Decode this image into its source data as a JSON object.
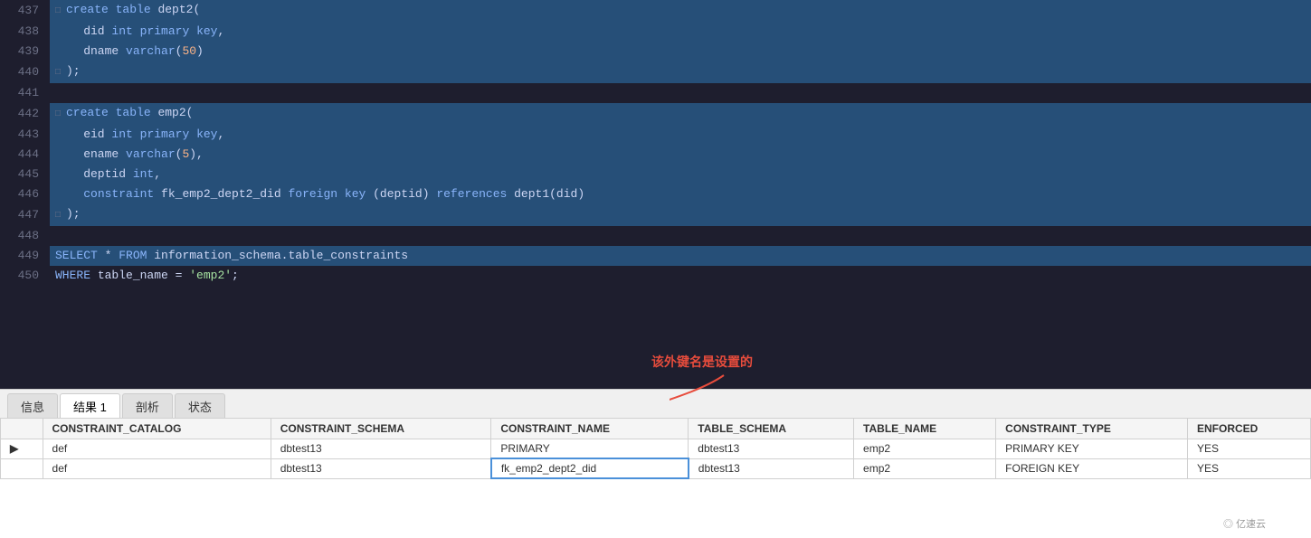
{
  "editor": {
    "lines": [
      {
        "num": "437",
        "selected": true,
        "content": [
          {
            "t": "□ ",
            "cls": "collapse-icon"
          },
          {
            "t": "create",
            "cls": "kw"
          },
          {
            "t": " ",
            "cls": "plain"
          },
          {
            "t": "table",
            "cls": "kw"
          },
          {
            "t": " dept2(",
            "cls": "plain"
          }
        ]
      },
      {
        "num": "438",
        "selected": true,
        "content": [
          {
            "t": "    did ",
            "cls": "plain"
          },
          {
            "t": "int",
            "cls": "kw"
          },
          {
            "t": " ",
            "cls": "plain"
          },
          {
            "t": "primary",
            "cls": "kw"
          },
          {
            "t": " ",
            "cls": "plain"
          },
          {
            "t": "key",
            "cls": "kw"
          },
          {
            "t": ",",
            "cls": "plain"
          }
        ]
      },
      {
        "num": "439",
        "selected": true,
        "content": [
          {
            "t": "    dname ",
            "cls": "plain"
          },
          {
            "t": "varchar",
            "cls": "kw"
          },
          {
            "t": "(",
            "cls": "plain"
          },
          {
            "t": "50",
            "cls": "num"
          },
          {
            "t": ")",
            "cls": "plain"
          }
        ]
      },
      {
        "num": "440",
        "selected": true,
        "content": [
          {
            "t": "□ ",
            "cls": "collapse-icon"
          },
          {
            "t": ");",
            "cls": "plain"
          }
        ]
      },
      {
        "num": "441",
        "selected": false,
        "content": []
      },
      {
        "num": "442",
        "selected": true,
        "content": [
          {
            "t": "□ ",
            "cls": "collapse-icon"
          },
          {
            "t": "create",
            "cls": "kw"
          },
          {
            "t": " ",
            "cls": "plain"
          },
          {
            "t": "table",
            "cls": "kw"
          },
          {
            "t": " emp2(",
            "cls": "plain"
          }
        ]
      },
      {
        "num": "443",
        "selected": true,
        "content": [
          {
            "t": "    eid ",
            "cls": "plain"
          },
          {
            "t": "int",
            "cls": "kw"
          },
          {
            "t": " ",
            "cls": "plain"
          },
          {
            "t": "primary",
            "cls": "kw"
          },
          {
            "t": " ",
            "cls": "plain"
          },
          {
            "t": "key",
            "cls": "kw"
          },
          {
            "t": ",",
            "cls": "plain"
          }
        ]
      },
      {
        "num": "444",
        "selected": true,
        "content": [
          {
            "t": "    ename ",
            "cls": "plain"
          },
          {
            "t": "varchar",
            "cls": "kw"
          },
          {
            "t": "(",
            "cls": "plain"
          },
          {
            "t": "5",
            "cls": "num"
          },
          {
            "t": "),",
            "cls": "plain"
          }
        ]
      },
      {
        "num": "445",
        "selected": true,
        "content": [
          {
            "t": "    deptid ",
            "cls": "plain"
          },
          {
            "t": "int",
            "cls": "kw"
          },
          {
            "t": ",",
            "cls": "plain"
          }
        ]
      },
      {
        "num": "446",
        "selected": true,
        "content": [
          {
            "t": "    ",
            "cls": "plain"
          },
          {
            "t": "constraint",
            "cls": "kw"
          },
          {
            "t": " fk_emp2_dept2_did ",
            "cls": "plain"
          },
          {
            "t": "foreign",
            "cls": "kw"
          },
          {
            "t": " ",
            "cls": "plain"
          },
          {
            "t": "key",
            "cls": "kw"
          },
          {
            "t": " (deptid) ",
            "cls": "plain"
          },
          {
            "t": "references",
            "cls": "kw"
          },
          {
            "t": " dept1(did)",
            "cls": "plain"
          }
        ]
      },
      {
        "num": "447",
        "selected": true,
        "content": [
          {
            "t": "□ ",
            "cls": "collapse-icon"
          },
          {
            "t": ");",
            "cls": "plain"
          }
        ]
      },
      {
        "num": "448",
        "selected": false,
        "content": []
      },
      {
        "num": "449",
        "selected": true,
        "content": [
          {
            "t": "SELECT",
            "cls": "kw"
          },
          {
            "t": " * ",
            "cls": "plain"
          },
          {
            "t": "FROM",
            "cls": "kw"
          },
          {
            "t": " information_schema.table_constraints",
            "cls": "plain"
          }
        ]
      },
      {
        "num": "450",
        "selected": false,
        "content": [
          {
            "t": "WHERE",
            "cls": "kw"
          },
          {
            "t": " table_name = ",
            "cls": "plain"
          },
          {
            "t": "'emp2'",
            "cls": "str"
          },
          {
            "t": ";",
            "cls": "plain"
          }
        ]
      }
    ]
  },
  "tabs": {
    "items": [
      "信息",
      "结果 1",
      "剖析",
      "状态"
    ],
    "active": "结果 1"
  },
  "annotation": {
    "text": "该外键名是设置的"
  },
  "results": {
    "columns": [
      "",
      "CONSTRAINT_CATALOG",
      "CONSTRAINT_SCHEMA",
      "CONSTRAINT_NAME",
      "TABLE_SCHEMA",
      "TABLE_NAME",
      "CONSTRAINT_TYPE",
      "ENFORCED"
    ],
    "rows": [
      {
        "indicator": "▶",
        "cells": [
          "def",
          "dbtest13",
          "PRIMARY",
          "dbtest13",
          "emp2",
          "PRIMARY KEY",
          "YES"
        ],
        "highlight_col": 2
      },
      {
        "indicator": " ",
        "cells": [
          "def",
          "dbtest13",
          "fk_emp2_dept2_did",
          "dbtest13",
          "emp2",
          "FOREIGN KEY",
          "YES"
        ],
        "highlight_col": 2
      }
    ]
  },
  "watermark": {
    "text": "◎ 亿速云"
  }
}
